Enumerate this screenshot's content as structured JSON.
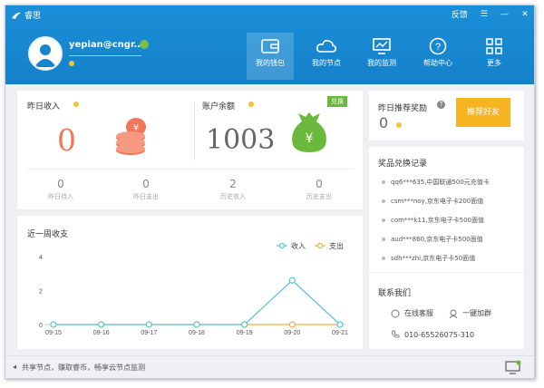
{
  "app": {
    "name": "睿思"
  },
  "window_controls": {
    "feedback": "反馈",
    "menu": "☰",
    "minimize": "—",
    "close": "✕"
  },
  "user": {
    "name": "yepian@cngr...."
  },
  "nav": [
    {
      "label": "我的钱包",
      "icon": "wallet-icon",
      "active": true
    },
    {
      "label": "我的节点",
      "icon": "cloud-icon",
      "active": false
    },
    {
      "label": "我的监测",
      "icon": "monitor-icon",
      "active": false
    },
    {
      "label": "帮助中心",
      "icon": "help-icon",
      "active": false
    },
    {
      "label": "更多",
      "icon": "grid-icon",
      "active": false
    }
  ],
  "income": {
    "label": "昨日收入",
    "value": "0"
  },
  "balance": {
    "label": "账户余额",
    "value": "1003",
    "exchange": "兑换"
  },
  "stats": [
    {
      "value": "0",
      "label": "昨日待入"
    },
    {
      "value": "0",
      "label": "昨日支出"
    },
    {
      "value": "2",
      "label": "历史收入"
    },
    {
      "value": "0",
      "label": "历史支出"
    }
  ],
  "referral": {
    "label": "昨日推荐奖励",
    "value": "0",
    "button": "推荐好友"
  },
  "records": {
    "title": "奖品兑换记录",
    "items": [
      "qq6***635,中国联通500元充值卡",
      "csm***noy,京东电子卡200面值",
      "com***k11,京东电子卡500面值",
      "aud***860,京东电子卡500面值",
      "sdh***zhi,京东电子卡50面值"
    ]
  },
  "contact": {
    "title": "联系我们",
    "service": "在线客服",
    "group": "一键加群",
    "phone": "010-65526075-310"
  },
  "footer": {
    "text": "共享节点，赚取睿币，畅享云节点监测"
  },
  "colors": {
    "header": "#1785cd",
    "income_accent": "#f0785a",
    "balance_accent": "#6ab83c",
    "button": "#f7b421",
    "expense_line": "#f0b23c",
    "income_line": "#5ac6d8"
  },
  "chart_data": {
    "type": "line",
    "title": "近一周收支",
    "categories": [
      "09-15",
      "09-16",
      "09-17",
      "09-18",
      "09-19",
      "09-20",
      "09-21"
    ],
    "series": [
      {
        "name": "收入",
        "values": [
          0,
          0,
          0,
          0,
          0,
          2.6,
          0
        ],
        "color": "#5ac6d8"
      },
      {
        "name": "支出",
        "values": [
          0,
          0,
          0,
          0,
          0,
          0,
          0
        ],
        "color": "#f0b23c"
      }
    ],
    "y_ticks": [
      "0",
      "2",
      "4"
    ],
    "ylim": [
      0,
      4
    ],
    "legend": "top-right",
    "grid": false
  }
}
